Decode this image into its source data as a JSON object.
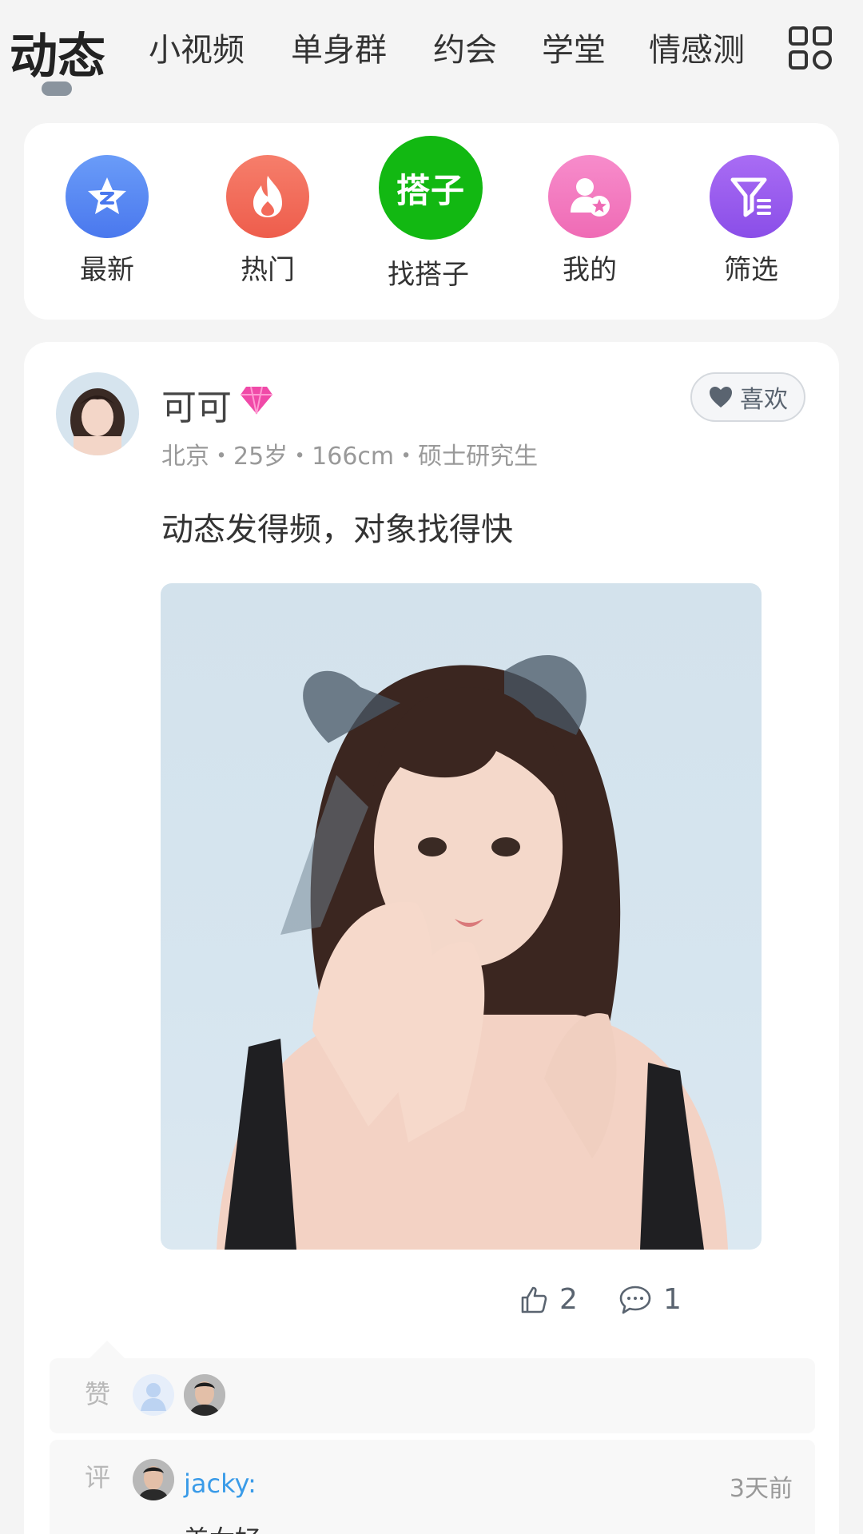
{
  "tabs": [
    {
      "label": "动态",
      "active": true
    },
    {
      "label": "小视频"
    },
    {
      "label": "单身群"
    },
    {
      "label": "约会"
    },
    {
      "label": "学堂"
    },
    {
      "label": "情感测"
    }
  ],
  "categories": [
    {
      "label": "最新",
      "icon": "star-z-icon",
      "color": "#5b8cf5"
    },
    {
      "label": "热门",
      "icon": "flame-icon",
      "color": "#f36a5a"
    },
    {
      "label": "找搭子",
      "icon": "partner-icon",
      "badge_text": "搭子",
      "color": "#12b812"
    },
    {
      "label": "我的",
      "icon": "user-star-icon",
      "color": "#f27fc0"
    },
    {
      "label": "筛选",
      "icon": "filter-icon",
      "color": "#9b5cf0"
    }
  ],
  "post": {
    "username": "可可",
    "meta": "北京・25岁・166cm・硕士研究生",
    "like_label": "喜欢",
    "text": "动态发得频，对象找得快",
    "thumbs_count": "2",
    "comment_count": "1"
  },
  "likes": {
    "label": "赞"
  },
  "comments": {
    "label": "评",
    "items": [
      {
        "user": "jacky:",
        "time": "3天前",
        "text": "美女好"
      }
    ]
  },
  "colors": {
    "accent": "#3a9be8",
    "page_bg": "#f4f4f4"
  }
}
